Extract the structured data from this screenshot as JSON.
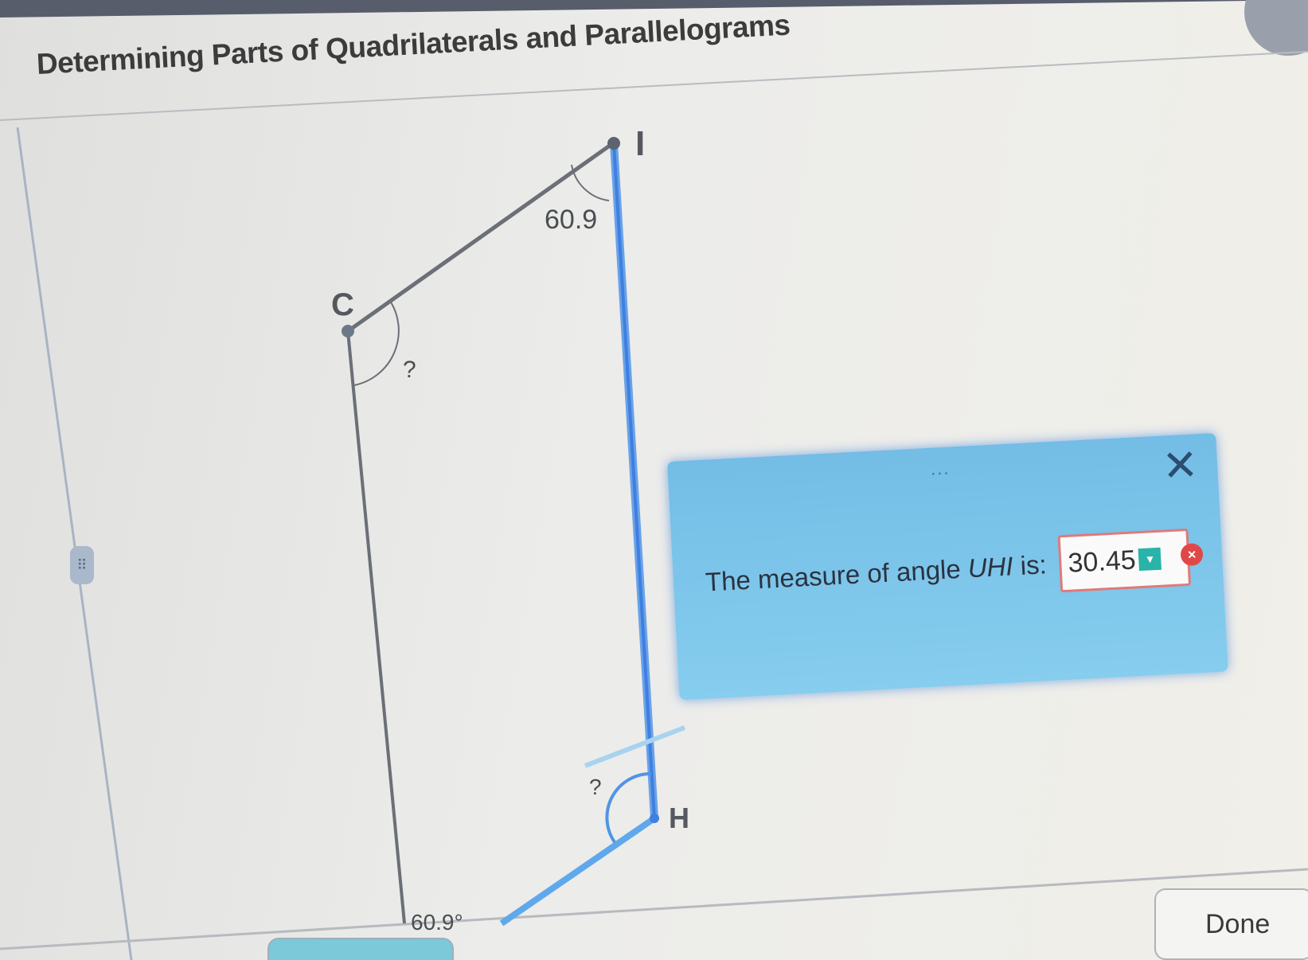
{
  "header": {
    "title": "Determining Parts of Quadrilaterals and Parallelograms"
  },
  "figure": {
    "vertex_labels": {
      "I": "I",
      "C": "C",
      "H": "H"
    },
    "angle_labels": {
      "at_I": "60.9",
      "at_C": "?",
      "at_H": "?",
      "bottom": "60.9°"
    }
  },
  "popup": {
    "menu_dots": "...",
    "close_icon": "close-x",
    "prompt_prefix": "The measure of angle ",
    "prompt_angle": "UHI",
    "prompt_suffix": " is:",
    "answer_value": "30.45",
    "dropdown_icon": "chevron-down",
    "clear_icon": "x-circle"
  },
  "sidebar": {
    "handle_icon": "grip-dots"
  },
  "footer": {
    "done_label": "Done"
  },
  "colors": {
    "accent_blue": "#3f7fe0",
    "popup_bg": "#7cc4e9",
    "answer_border": "#e07a7a",
    "dropdown_teal": "#2ab3a8",
    "error_red": "#e04848"
  }
}
